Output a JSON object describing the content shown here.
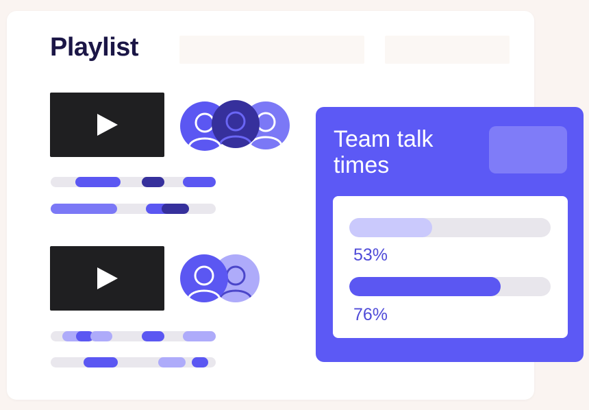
{
  "playlist": {
    "title": "Playlist",
    "videos": [
      {
        "tracks": [
          [
            {
              "l": 36,
              "w": 66,
              "c": "blue"
            },
            {
              "l": 133,
              "w": 33,
              "c": "dark"
            },
            {
              "l": 193,
              "w": 48,
              "c": "blue"
            }
          ],
          [
            {
              "l": 0,
              "w": 97,
              "c": "mid"
            },
            {
              "l": 139,
              "w": 48,
              "c": "blue"
            },
            {
              "l": 162,
              "w": 40,
              "c": "dark"
            }
          ]
        ]
      },
      {
        "tracks": [
          [
            {
              "l": 17,
              "w": 38,
              "c": "light"
            },
            {
              "l": 37,
              "w": 26,
              "c": "blue"
            },
            {
              "l": 58,
              "w": 32,
              "c": "light"
            },
            {
              "l": 133,
              "w": 33,
              "c": "blue"
            },
            {
              "l": 193,
              "w": 48,
              "c": "light"
            }
          ],
          [
            {
              "l": 48,
              "w": 50,
              "c": "blue"
            },
            {
              "l": 157,
              "w": 40,
              "c": "light"
            },
            {
              "l": 206,
              "w": 24,
              "c": "blue"
            }
          ]
        ]
      }
    ]
  },
  "team_talk": {
    "title": "Team talk times",
    "bars": [
      {
        "value": 0.41,
        "label": "53%",
        "color": "#cac9fc"
      },
      {
        "value": 0.75,
        "label": "76%",
        "color": "#5b57f2"
      }
    ]
  },
  "colors": {
    "accent": "#5c59f5",
    "blue": "#5b57f2",
    "dark": "#36309c",
    "light": "#aeabfa",
    "mid": "#7b78f6"
  },
  "icons": {
    "play": "play-icon",
    "user": "user-icon"
  }
}
